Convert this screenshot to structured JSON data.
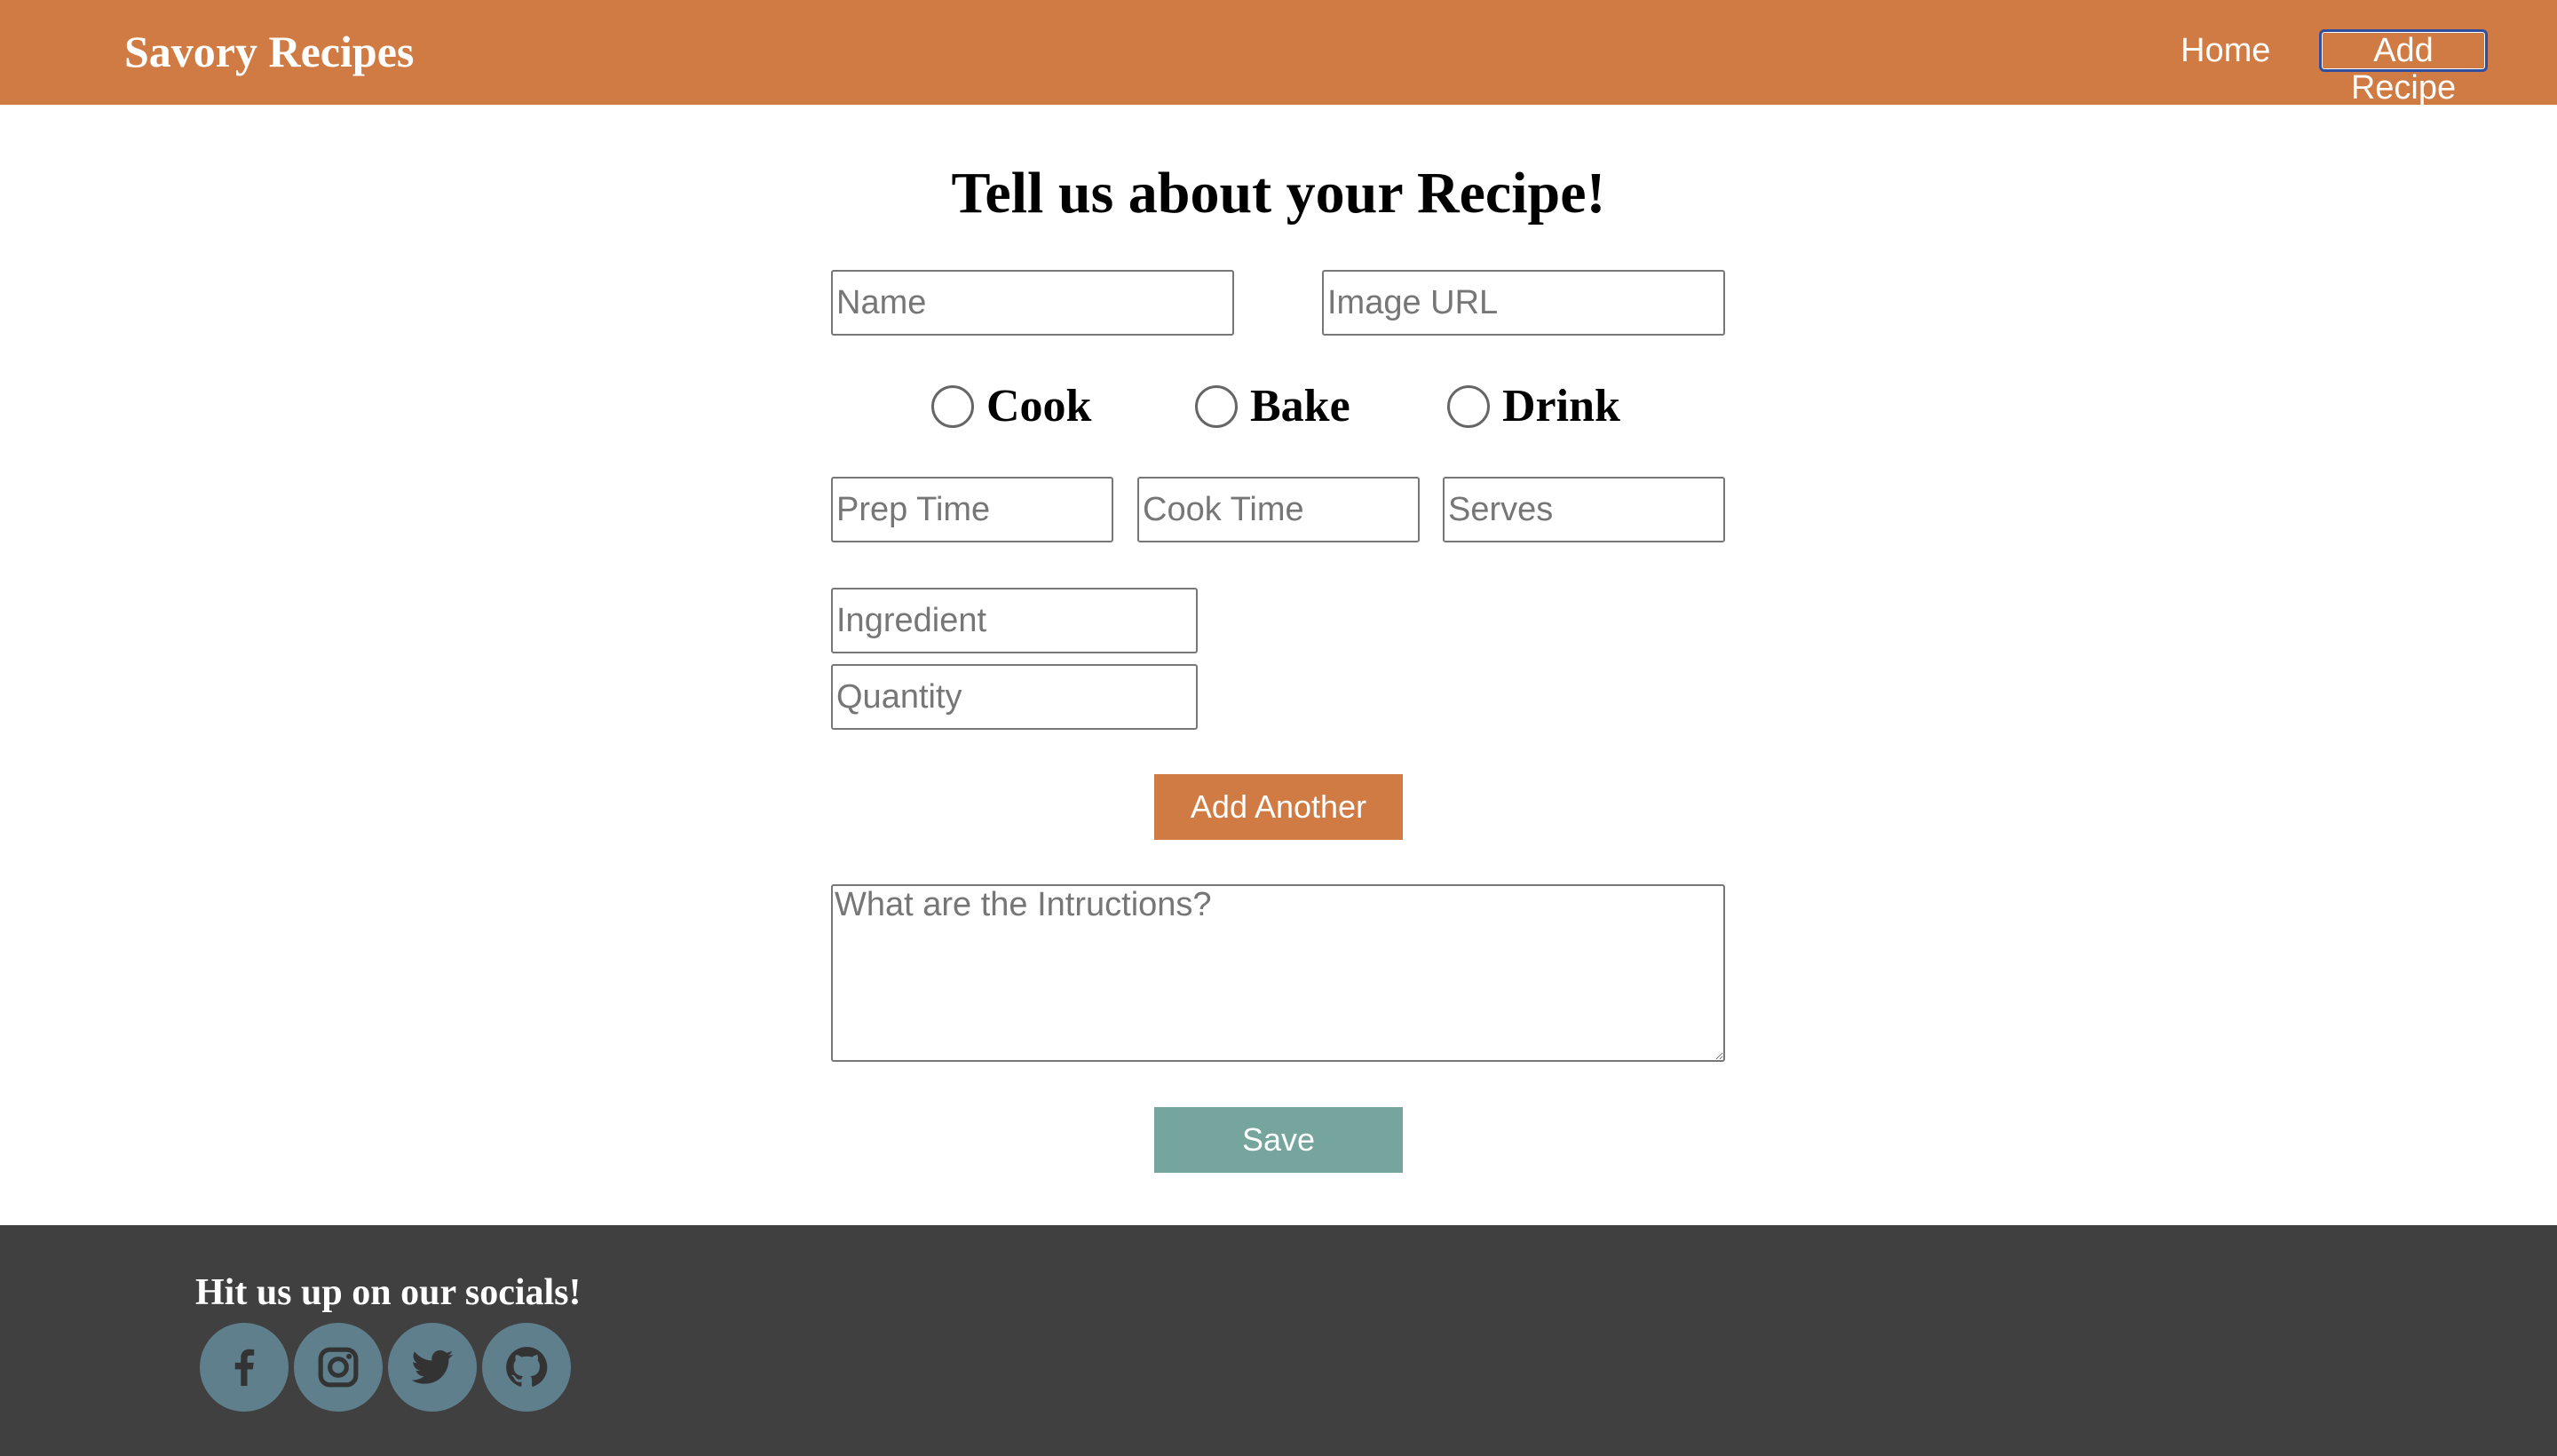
{
  "navbar": {
    "brand": "Savory Recipes",
    "links": [
      "Home",
      "Add Recipe"
    ],
    "background": "#d07b43"
  },
  "page": {
    "title": "Tell us about your Recipe!"
  },
  "form": {
    "name_placeholder": "Name",
    "image_url_placeholder": "Image URL",
    "types": [
      "Cook",
      "Bake",
      "Drink"
    ],
    "prep_time_placeholder": "Prep Time",
    "cook_time_placeholder": "Cook Time",
    "serves_placeholder": "Serves",
    "ingredient_placeholder": "Ingredient",
    "quantity_placeholder": "Quantity",
    "add_another_label": "Add Another",
    "instructions_placeholder": "What are the Intructions?",
    "save_label": "Save"
  },
  "footer": {
    "heading": "Hit us up on our socials!",
    "socials": [
      "facebook-icon",
      "instagram-icon",
      "twitter-icon",
      "github-icon"
    ],
    "background": "#404040",
    "icon_color": "#5f7f8d"
  },
  "colors": {
    "accent": "#d07b43",
    "save": "#76a59e"
  }
}
